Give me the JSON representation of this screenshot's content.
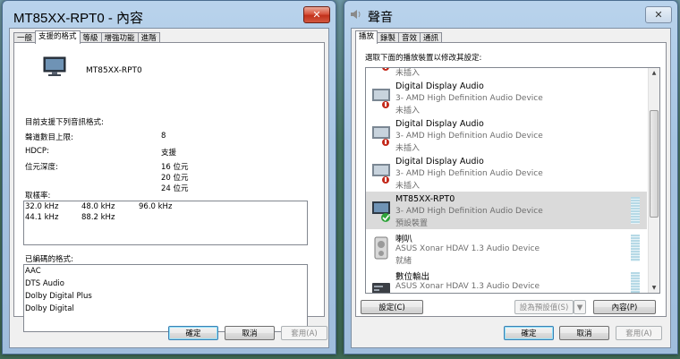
{
  "left_window": {
    "title": "MT85XX-RPT0 - 內容",
    "close_label": "✕",
    "tabs": [
      "一般",
      "支援的格式",
      "等級",
      "增強功能",
      "進階"
    ],
    "device_name": "MT85XX-RPT0",
    "formats_heading": "目前支援下列音訊格式:",
    "specs": [
      {
        "label": "聲道數目上限:",
        "value": "8"
      },
      {
        "label": "HDCP:",
        "value": "支援"
      },
      {
        "label": "位元深度:",
        "value": "16 位元"
      }
    ],
    "bit_depth_extra": [
      "20 位元",
      "24 位元"
    ],
    "sample_rate_label": "取樣率:",
    "sample_rates": [
      "32.0 kHz",
      "48.0 kHz",
      "96.0 kHz",
      "44.1 kHz",
      "88.2 kHz"
    ],
    "encoded_label": "已編碼的格式:",
    "encoded_formats": [
      "AAC",
      "DTS Audio",
      "Dolby Digital Plus",
      "Dolby Digital"
    ],
    "buttons": {
      "ok": "確定",
      "cancel": "取消",
      "apply": "套用(A)"
    }
  },
  "right_window": {
    "title": "聲音",
    "close_label": "✕",
    "tabs": [
      "播放",
      "錄製",
      "音效",
      "通訊"
    ],
    "instruction": "選取下面的播放裝置以修改其設定:",
    "partial_status": "未插入",
    "devices": [
      {
        "name": "Digital Display Audio",
        "sub": "3- AMD High Definition Audio Device",
        "status": "未插入"
      },
      {
        "name": "Digital Display Audio",
        "sub": "3- AMD High Definition Audio Device",
        "status": "未插入"
      },
      {
        "name": "Digital Display Audio",
        "sub": "3- AMD High Definition Audio Device",
        "status": "未插入"
      },
      {
        "name": "MT85XX-RPT0",
        "sub": "3- AMD High Definition Audio Device",
        "status": "預設裝置"
      },
      {
        "name": "喇叭",
        "sub": "ASUS Xonar HDAV 1.3 Audio Device",
        "status": "就緒"
      },
      {
        "name": "數位輸出",
        "sub": "ASUS Xonar HDAV 1.3 Audio Device",
        "status": ""
      }
    ],
    "buttons": {
      "configure": "設定(C)",
      "set_default": "設為預設值(S)",
      "properties": "內容(P)",
      "ok": "確定",
      "cancel": "取消",
      "apply": "套用(A)"
    }
  }
}
